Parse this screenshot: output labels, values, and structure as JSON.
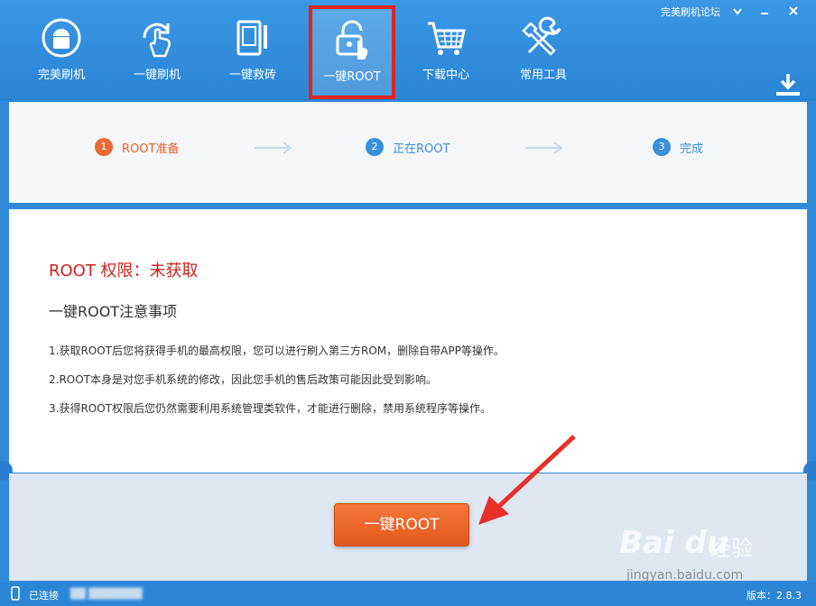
{
  "titlebar": {
    "forum_link": "完美刷机论坛",
    "menu_icon": "chevron-down-icon",
    "minimize_icon": "minimize-icon",
    "close_icon": "close-icon"
  },
  "nav": {
    "items": [
      {
        "label": "完美刷机",
        "icon": "android-icon"
      },
      {
        "label": "一键刷机",
        "icon": "hand-refresh-icon"
      },
      {
        "label": "一键救砖",
        "icon": "brick-wrench-icon"
      },
      {
        "label": "一键ROOT",
        "icon": "unlock-icon",
        "active": true
      },
      {
        "label": "下载中心",
        "icon": "cart-icon"
      },
      {
        "label": "常用工具",
        "icon": "tools-icon"
      }
    ],
    "download_icon": "download-icon"
  },
  "steps": [
    {
      "num": "1",
      "label": "ROOT准备",
      "state": "current"
    },
    {
      "num": "2",
      "label": "正在ROOT",
      "state": "pending"
    },
    {
      "num": "3",
      "label": "完成",
      "state": "pending"
    }
  ],
  "content": {
    "root_status": "ROOT 权限：未获取",
    "notes_title": "一键ROOT注意事项",
    "notes": [
      "1.获取ROOT后您将获得手机的最高权限，您可以进行刷入第三方ROM，删除自带APP等操作。",
      "2.ROOT本身是对您手机系统的修改，因此您手机的售后政策可能因此受到影响。",
      "3.获得ROOT权限后您仍然需要利用系统管理类软件，才能进行删除，禁用系统程序等操作。"
    ]
  },
  "action": {
    "root_button": "一键ROOT"
  },
  "statusbar": {
    "connected": "已连接",
    "device_name": "██ ███████",
    "version": "版本：2.8.3"
  },
  "watermark": {
    "brand": "Bai du",
    "brand_cn": "经验",
    "url": "jingyan.baidu.com"
  },
  "colors": {
    "primary": "#2c86d6",
    "accent": "#e86a34",
    "highlight_border": "#e0241e",
    "status_red": "#cf2121"
  }
}
